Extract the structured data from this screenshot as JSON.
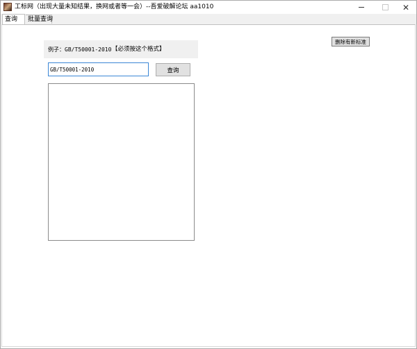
{
  "window": {
    "title": "工标网（出现大量未知结果，换网或者等一会）--吾爱破解论坛 aa1010",
    "icon": "app-icon"
  },
  "tabs": [
    {
      "label": "查询",
      "active": true
    },
    {
      "label": "批量查询",
      "active": false
    }
  ],
  "query_tab": {
    "example_label": "例子：GB/T50001-2010",
    "format_note": "【必须按这个格式】",
    "input_value": "GB/T50001-2010",
    "query_button": "查询",
    "results_text": ""
  },
  "delete_button": "删除有新标准",
  "colors": {
    "input_border_focus": "#3a86d6",
    "button_bg": "#e1e1e1",
    "panel_bg": "#f0f0f0"
  }
}
